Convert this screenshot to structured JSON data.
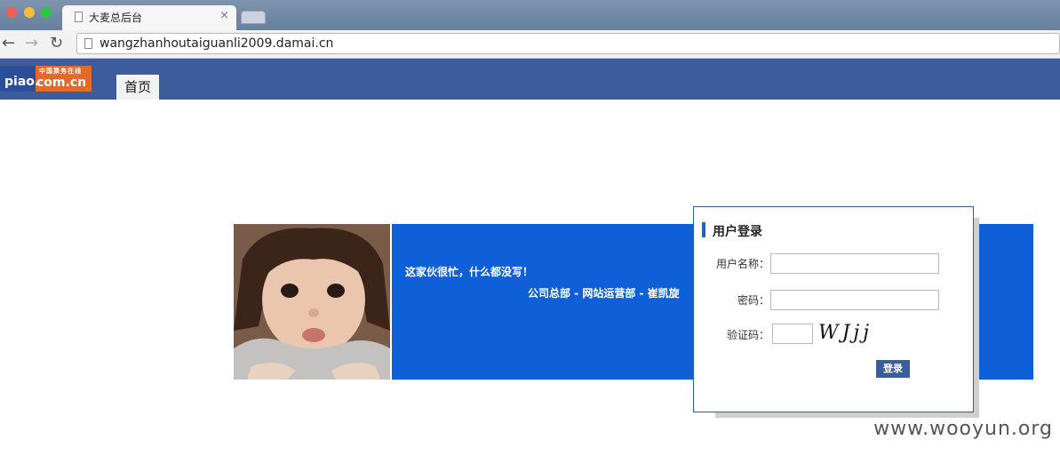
{
  "browser": {
    "tab_title": "大麦总后台",
    "tab_close": "×",
    "url": "wangzhanhoutaiguanli2009.damai.cn",
    "back_glyph": "←",
    "forward_glyph": "→",
    "reload_glyph": "↻"
  },
  "site": {
    "logo": {
      "small_text": "中国票务在线",
      "piao": "piao.",
      "domain": "com.cn"
    },
    "nav": {
      "home": "首页"
    }
  },
  "banner": {
    "line1": "这家伙很忙，什么都没写！",
    "line2": "公司总部 - 网站运营部 - 崔凯旋"
  },
  "login": {
    "title": "用户登录",
    "username_label": "用户名称：",
    "username_value": "",
    "password_label": "密码：",
    "password_value": "",
    "captcha_label": "验证码：",
    "captcha_value": "",
    "captcha_text": "WJjj",
    "submit": "登录"
  },
  "watermark": "www.wooyun.org",
  "colors": {
    "header_bg": "#3d5c9b",
    "banner_bg": "#0f5fd8",
    "login_border": "#2e5d9b",
    "button_bg": "#3d5c9b"
  }
}
